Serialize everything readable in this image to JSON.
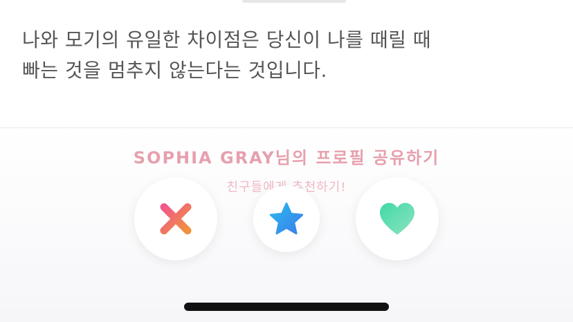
{
  "profile": {
    "bio_lines": [
      "나와 모기의 유일한 차이점은 당신이 나를 때릴 때",
      "빠는 것을 멈추지 않는다는 것입니다."
    ],
    "share_link": "SOPHIA GRAY님의 프로필 공유하기",
    "recommend_text": "친구들에게 추천하기!"
  },
  "actions": {
    "nope_icon": "close-x-icon",
    "super_like_icon": "star-icon",
    "like_icon": "heart-icon"
  },
  "colors": {
    "bio_text": "#555555",
    "share_link": "#e6a0ad",
    "nope_gradient": [
      "#f0578a",
      "#f0923e"
    ],
    "super_like_gradient": [
      "#2bb8f0",
      "#3b7ee8"
    ],
    "like_gradient": [
      "#3fd9a6",
      "#8fe3c0"
    ]
  }
}
